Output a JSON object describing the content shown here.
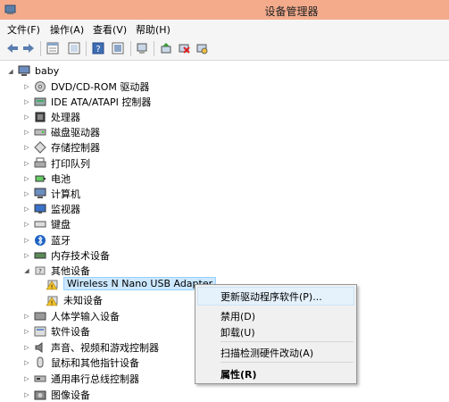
{
  "window": {
    "title": "设备管理器"
  },
  "menu": [
    "文件(F)",
    "操作(A)",
    "查看(V)",
    "帮助(H)"
  ],
  "toolbar_icons": [
    "back-icon",
    "forward-icon",
    "properties-icon",
    "refresh-icon",
    "help-icon",
    "show-hidden-icon",
    "update-driver-icon",
    "uninstall-icon",
    "scan-hardware-icon"
  ],
  "tree": {
    "root": "baby",
    "items": [
      "DVD/CD-ROM 驱动器",
      "IDE ATA/ATAPI 控制器",
      "处理器",
      "磁盘驱动器",
      "存储控制器",
      "打印队列",
      "电池",
      "计算机",
      "监视器",
      "键盘",
      "蓝牙",
      "内存技术设备",
      "其他设备"
    ],
    "other_devices": [
      "Wireless N Nano USB Adapter",
      "未知设备"
    ],
    "items_after": [
      "人体学输入设备",
      "软件设备",
      "声音、视频和游戏控制器",
      "鼠标和其他指针设备",
      "通用串行总线控制器",
      "图像设备"
    ]
  },
  "context_menu": {
    "items": [
      "更新驱动程序软件(P)...",
      "禁用(D)",
      "卸载(U)",
      "扫描检测硬件改动(A)",
      "属性(R)"
    ]
  }
}
